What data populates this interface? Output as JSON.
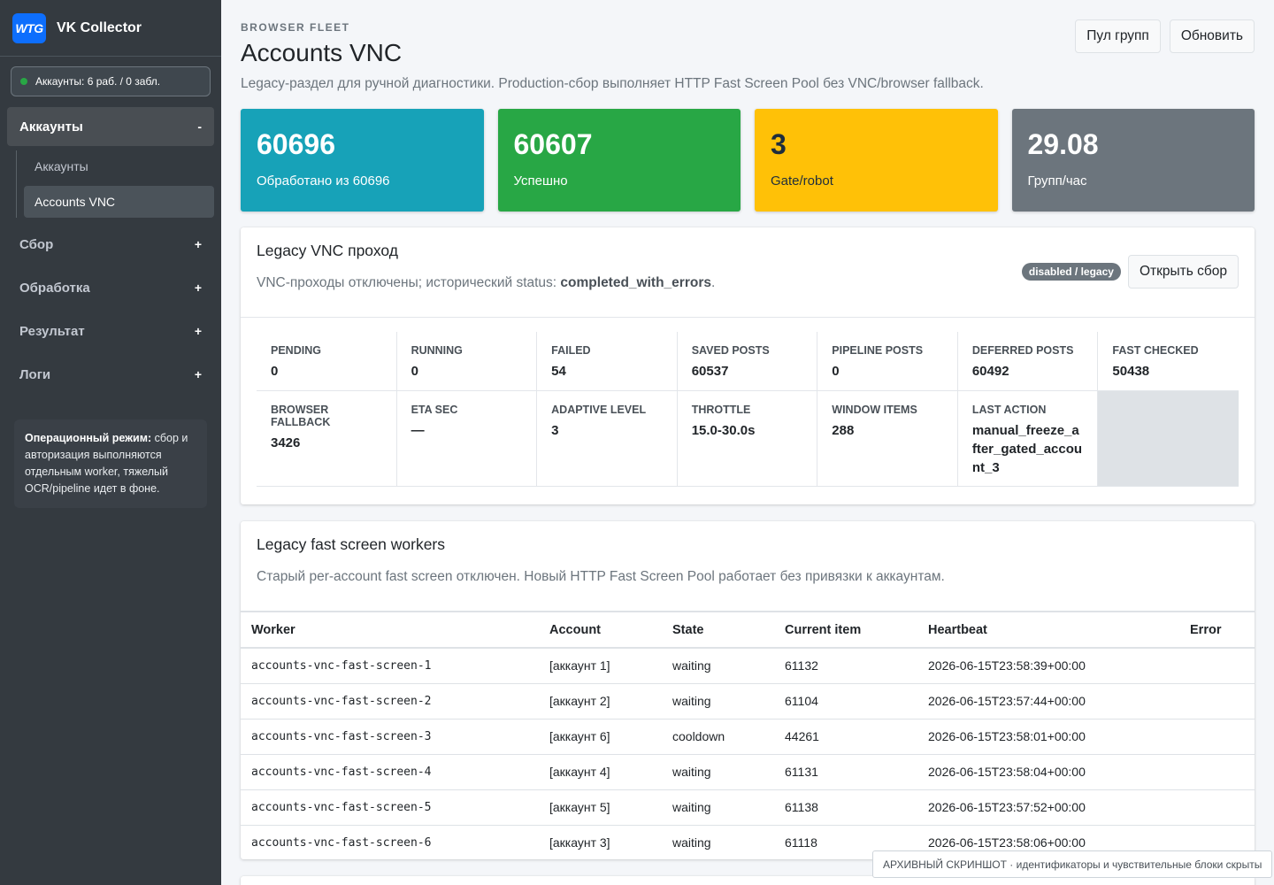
{
  "brand": {
    "logo": "WTG",
    "name": "VK Collector"
  },
  "status_pill": "Аккаунты: 6 раб. / 0 забл.",
  "nav": {
    "sections": [
      {
        "label": "Аккаунты",
        "toggle": "-",
        "expanded": true,
        "items": [
          "Аккаунты",
          "Accounts VNC"
        ],
        "active_item": "Accounts VNC"
      },
      {
        "label": "Сбор",
        "toggle": "+"
      },
      {
        "label": "Обработка",
        "toggle": "+"
      },
      {
        "label": "Результат",
        "toggle": "+"
      },
      {
        "label": "Логи",
        "toggle": "+"
      }
    ]
  },
  "info_box": {
    "bold": "Операционный режим:",
    "text": " сбор и авторизация выполняются отдельным worker, тяжелый OCR/pipeline идет в фоне."
  },
  "header": {
    "eyebrow": "BROWSER FLEET",
    "title": "Accounts VNC",
    "subtitle": "Legacy-раздел для ручной диагностики. Production-сбор выполняет HTTP Fast Screen Pool без VNC/browser fallback.",
    "buttons": [
      "Пул групп",
      "Обновить"
    ]
  },
  "stats": [
    {
      "value": "60696",
      "label": "Обработано из 60696",
      "color": "#17a2b8"
    },
    {
      "value": "60607",
      "label": "Успешно",
      "color": "#28a745"
    },
    {
      "value": "3",
      "label": "Gate/robot",
      "color": "#ffc107"
    },
    {
      "value": "29.08",
      "label": "Групп/час",
      "color": "#6c757d"
    }
  ],
  "vnc_card": {
    "title": "Legacy VNC проход",
    "text_prefix": "VNC-проходы отключены; исторический status: ",
    "status": "completed_with_errors",
    "text_suffix": ".",
    "badge": "disabled / legacy",
    "button": "Открыть сбор",
    "metrics": [
      {
        "label": "PENDING",
        "value": "0"
      },
      {
        "label": "RUNNING",
        "value": "0"
      },
      {
        "label": "FAILED",
        "value": "54"
      },
      {
        "label": "SAVED POSTS",
        "value": "60537"
      },
      {
        "label": "PIPELINE POSTS",
        "value": "0"
      },
      {
        "label": "DEFERRED POSTS",
        "value": "60492"
      },
      {
        "label": "FAST CHECKED",
        "value": "50438"
      },
      {
        "label": "BROWSER FALLBACK",
        "value": "3426"
      },
      {
        "label": "ETA SEC",
        "value": "—"
      },
      {
        "label": "ADAPTIVE LEVEL",
        "value": "3"
      },
      {
        "label": "THROTTLE",
        "value": "15.0-30.0s"
      },
      {
        "label": "WINDOW ITEMS",
        "value": "288"
      },
      {
        "label": "LAST ACTION",
        "value": "manual_freeze_after_gated_account_3"
      }
    ]
  },
  "workers_card": {
    "title": "Legacy fast screen workers",
    "text": "Старый per-account fast screen отключен. Новый HTTP Fast Screen Pool работает без привязки к аккаунтам.",
    "columns": [
      "Worker",
      "Account",
      "State",
      "Current item",
      "Heartbeat",
      "Error"
    ],
    "rows": [
      [
        "accounts-vnc-fast-screen-1",
        "[аккаунт 1]",
        "waiting",
        "61132",
        "2026-06-15T23:58:39+00:00",
        ""
      ],
      [
        "accounts-vnc-fast-screen-2",
        "[аккаунт 2]",
        "waiting",
        "61104",
        "2026-06-15T23:57:44+00:00",
        ""
      ],
      [
        "accounts-vnc-fast-screen-3",
        "[аккаунт 6]",
        "cooldown",
        "44261",
        "2026-06-15T23:58:01+00:00",
        ""
      ],
      [
        "accounts-vnc-fast-screen-4",
        "[аккаунт 4]",
        "waiting",
        "61131",
        "2026-06-15T23:58:04+00:00",
        ""
      ],
      [
        "accounts-vnc-fast-screen-5",
        "[аккаунт 5]",
        "waiting",
        "61138",
        "2026-06-15T23:57:52+00:00",
        ""
      ],
      [
        "accounts-vnc-fast-screen-6",
        "[аккаунт 3]",
        "waiting",
        "61118",
        "2026-06-15T23:58:06+00:00",
        ""
      ]
    ]
  },
  "watermark": "АРХИВНЫЙ СКРИНШОТ · идентификаторы и чувствительные блоки скрыты"
}
